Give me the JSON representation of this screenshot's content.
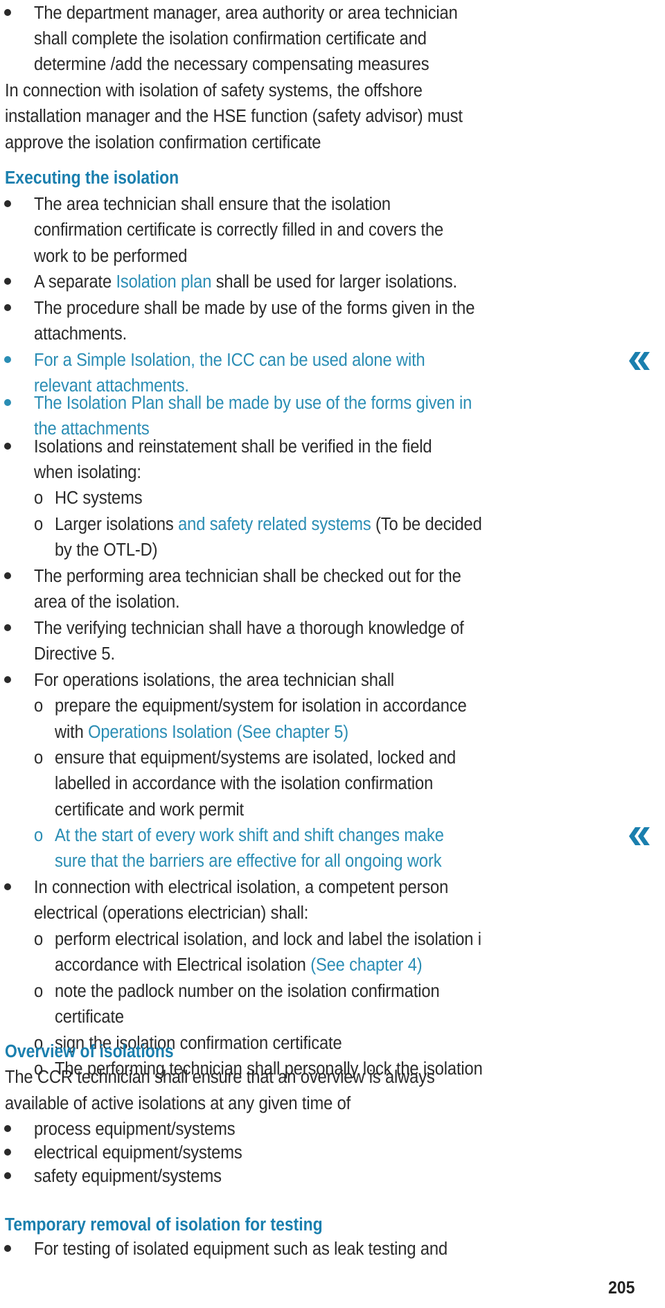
{
  "document": {
    "page_number": "205",
    "accent_color": "#1a7fae",
    "link_color": "#2a8db4",
    "intro": {
      "bullet": [
        "The department manager, area authority or area technician",
        "shall complete the isolation confirmation certificate and",
        "determine /add the necessary compensating measures"
      ],
      "paragraph": [
        "In connection with isolation of safety systems, the offshore",
        "installation manager and the HSE function (safety advisor) must",
        "approve the isolation confirmation certificate"
      ]
    },
    "sections": [
      {
        "heading": "Executing the isolation",
        "items": {
          "b1": [
            "The area technician shall ensure that the isolation",
            "confirmation certificate is correctly filled in and covers the",
            "work to be performed"
          ],
          "b2": {
            "pre": "A separate ",
            "link": "Isolation plan",
            "post": " shall be used for larger isolations."
          },
          "b3": [
            "The procedure shall be made by use of the forms given in the",
            "attachments."
          ],
          "b4": [
            "For a Simple Isolation, the ICC can be used alone with",
            "relevant attachments."
          ],
          "b5": [
            "The Isolation Plan shall be made by use of the forms given in",
            "the attachments"
          ],
          "b6": [
            "Isolations and reinstatement shall be verified in the field",
            "when isolating:"
          ],
          "b6_sub": {
            "s1": "HC systems",
            "s2": {
              "pre": "Larger isolations ",
              "link": "and safety related systems",
              "post": " (To be decided",
              "cont": "by the OTL-D)"
            }
          },
          "b7": [
            "The performing area technician shall be checked out for the",
            "area of the isolation."
          ],
          "b8": [
            "The verifying technician shall have a thorough knowledge of",
            "Directive 5."
          ],
          "b9": "For operations isolations, the area technician shall",
          "b9_sub": {
            "s1": {
              "line1": "prepare the equipment/system for isolation in accordance",
              "pre": "with ",
              "link": "Operations Isolation (See chapter 5)"
            },
            "s2": [
              "ensure that equipment/systems are isolated, locked and",
              "labelled in accordance with the isolation confirmation",
              "certificate and work permit"
            ],
            "s3": [
              "At the start of every work shift  and shift changes make",
              "sure that the barriers are effective for all ongoing work"
            ]
          },
          "b10": [
            "In connection with electrical isolation, a competent person",
            "electrical (operations electrician) shall:"
          ],
          "b10_sub": {
            "s1": {
              "line1": "perform electrical isolation, and lock and label the isolation i",
              "pre": "accordance with Electrical isolation ",
              "link": "(See chapter 4)"
            },
            "s2": [
              "note the padlock number on the isolation confirmation",
              "certificate"
            ],
            "s3": "sign the isolation confirmation certificate",
            "s4": "The performing technician shall personally lock the isolation"
          }
        },
        "sub_marker": "o",
        "change_mark": "«"
      },
      {
        "heading": "Overview of isolations",
        "paragraph": [
          "The CCR technician shall ensure that an overview is always",
          "available of active isolations at any given time of"
        ],
        "bullets": [
          "process equipment/systems",
          "electrical equipment/systems",
          "safety equipment/systems"
        ]
      },
      {
        "heading": "Temporary removal of isolation for testing",
        "bullets": [
          "For testing of isolated equipment such as leak testing and"
        ]
      }
    ]
  }
}
